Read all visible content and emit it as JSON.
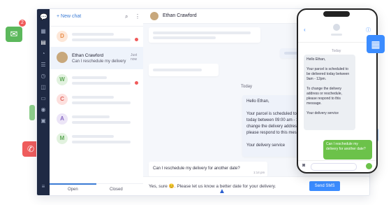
{
  "colors": {
    "rail": "#1f2a44",
    "accent": "#3b8cff",
    "phone_out": "#6cc24a",
    "unread": "#f05a5a"
  },
  "list": {
    "new_chat": "+ New chat",
    "tabs": {
      "open": "Open",
      "closed": "Closed"
    },
    "active_contact": {
      "name": "Ethan Crawford",
      "time": "Just now",
      "preview": "Can I reschedule my delivery"
    },
    "avatars": [
      "D",
      "W",
      "C",
      "A",
      "M"
    ]
  },
  "chat": {
    "contact_name": "Ethan Crawford",
    "day_label": "Today",
    "outgoing_message": "Hello Ethan,\n\nYour parcel is scheduled to be delivered today between 09:00 am - 12:00 am. To change the delivery address or reschedule, please respond to this message.\n\nYour delivery service",
    "incoming_message": "Can I reschedule my delivery for another date?",
    "incoming_time": "1:14 pm",
    "composer_text": "Yes, sure 😊. Please let us know a better date for your delivery.",
    "send_label": "Send SMS"
  },
  "phone": {
    "day_label": "Today",
    "incoming": "Hello Ethan,\n\nYour parcel is scheduled to be delivered today between 9am - 12pm.\n\nTo change the delivery address or reschedule, please respond to this message.\n\nYour delivery service",
    "outgoing": "Can I reschedule my delivery for another date?"
  },
  "floating": {
    "mail_badge": "2"
  }
}
